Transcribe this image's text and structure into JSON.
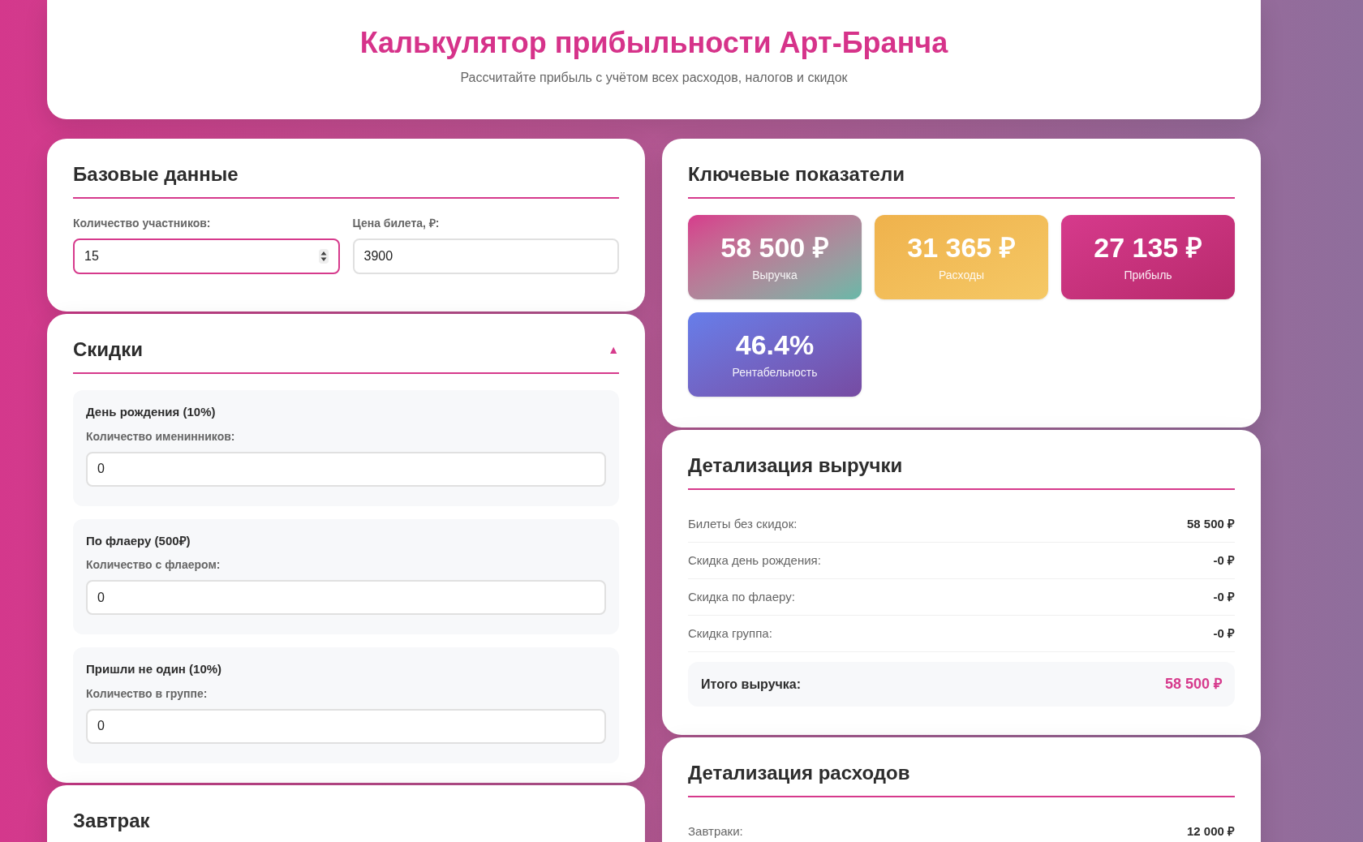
{
  "header": {
    "title": "Калькулятор прибыльности Арт-Бранча",
    "subtitle": "Рассчитайте прибыль с учётом всех расходов, налогов и скидок"
  },
  "base": {
    "title": "Базовые данные",
    "fields": [
      {
        "label": "Количество участников:",
        "value": "15",
        "focused": true
      },
      {
        "label": "Цена билета, ₽:",
        "value": "3900",
        "focused": false
      }
    ]
  },
  "discounts": {
    "title": "Скидки",
    "toggle": "▲",
    "expanded": true,
    "groups": [
      {
        "title": "День рождения (10%)",
        "label": "Количество именинников:",
        "value": "0"
      },
      {
        "title": "По флаеру (500₽)",
        "label": "Количество с флаером:",
        "value": "0"
      },
      {
        "title": "Пришли не один (10%)",
        "label": "Количество в группе:",
        "value": "0"
      }
    ]
  },
  "breakfast": {
    "title": "Завтрак"
  },
  "metrics": {
    "title": "Ключевые показатели",
    "items": [
      {
        "kind": "revenue",
        "value": "58 500 ₽",
        "label": "Выручка"
      },
      {
        "kind": "expenses",
        "value": "31 365 ₽",
        "label": "Расходы"
      },
      {
        "kind": "profit",
        "value": "27 135 ₽",
        "label": "Прибыль"
      },
      {
        "kind": "margin",
        "value": "46.4%",
        "label": "Рентабельность"
      }
    ]
  },
  "revenue": {
    "title": "Детализация выручки",
    "rows": [
      {
        "label": "Билеты без скидок:",
        "value": "58 500 ₽"
      },
      {
        "label": "Скидка день рождения:",
        "value": "-0 ₽"
      },
      {
        "label": "Скидка по флаеру:",
        "value": "-0 ₽"
      },
      {
        "label": "Скидка группа:",
        "value": "-0 ₽"
      }
    ],
    "total": {
      "label": "Итого выручка:",
      "value": "58 500 ₽"
    }
  },
  "expenses": {
    "title": "Детализация расходов",
    "rows": [
      {
        "label": "Завтраки:",
        "value": "12 000 ₽"
      }
    ]
  }
}
